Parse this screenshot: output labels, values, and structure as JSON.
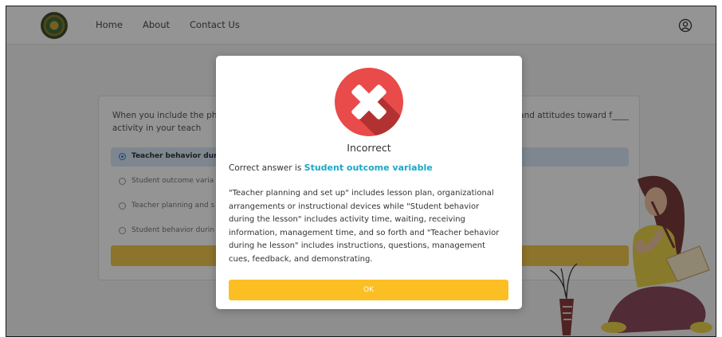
{
  "nav": {
    "home": "Home",
    "about": "About",
    "contact": "Contact Us"
  },
  "question": {
    "text_left": "When you include the ph the activity in your teach",
    "text_right": "s, and attitudes toward f____",
    "options": [
      "Teacher behavior duri",
      "Student outcome varia",
      "Teacher planning and s",
      "Student behavior durin"
    ],
    "selected_index": 0
  },
  "modal": {
    "title": "Incorrect",
    "answer_prefix": "Correct answer is ",
    "answer_value": "Student outcome variable",
    "explanation": "\"Teacher planning and set up\" includes lesson plan, organizational arrangements or instructional devices while \"Student behavior during the lesson\" includes activity time, waiting, receiving information, management time, and so forth and \"Teacher behavior during he lesson\" includes instructions, questions, management cues, feedback, and demonstrating.",
    "ok_label": "OK",
    "icon": "x-circle-icon"
  },
  "colors": {
    "accent": "#19a9c7",
    "ok_button": "#fbbf24",
    "error_icon": "#e94a4a",
    "selected_option": "#d9e9f7"
  }
}
